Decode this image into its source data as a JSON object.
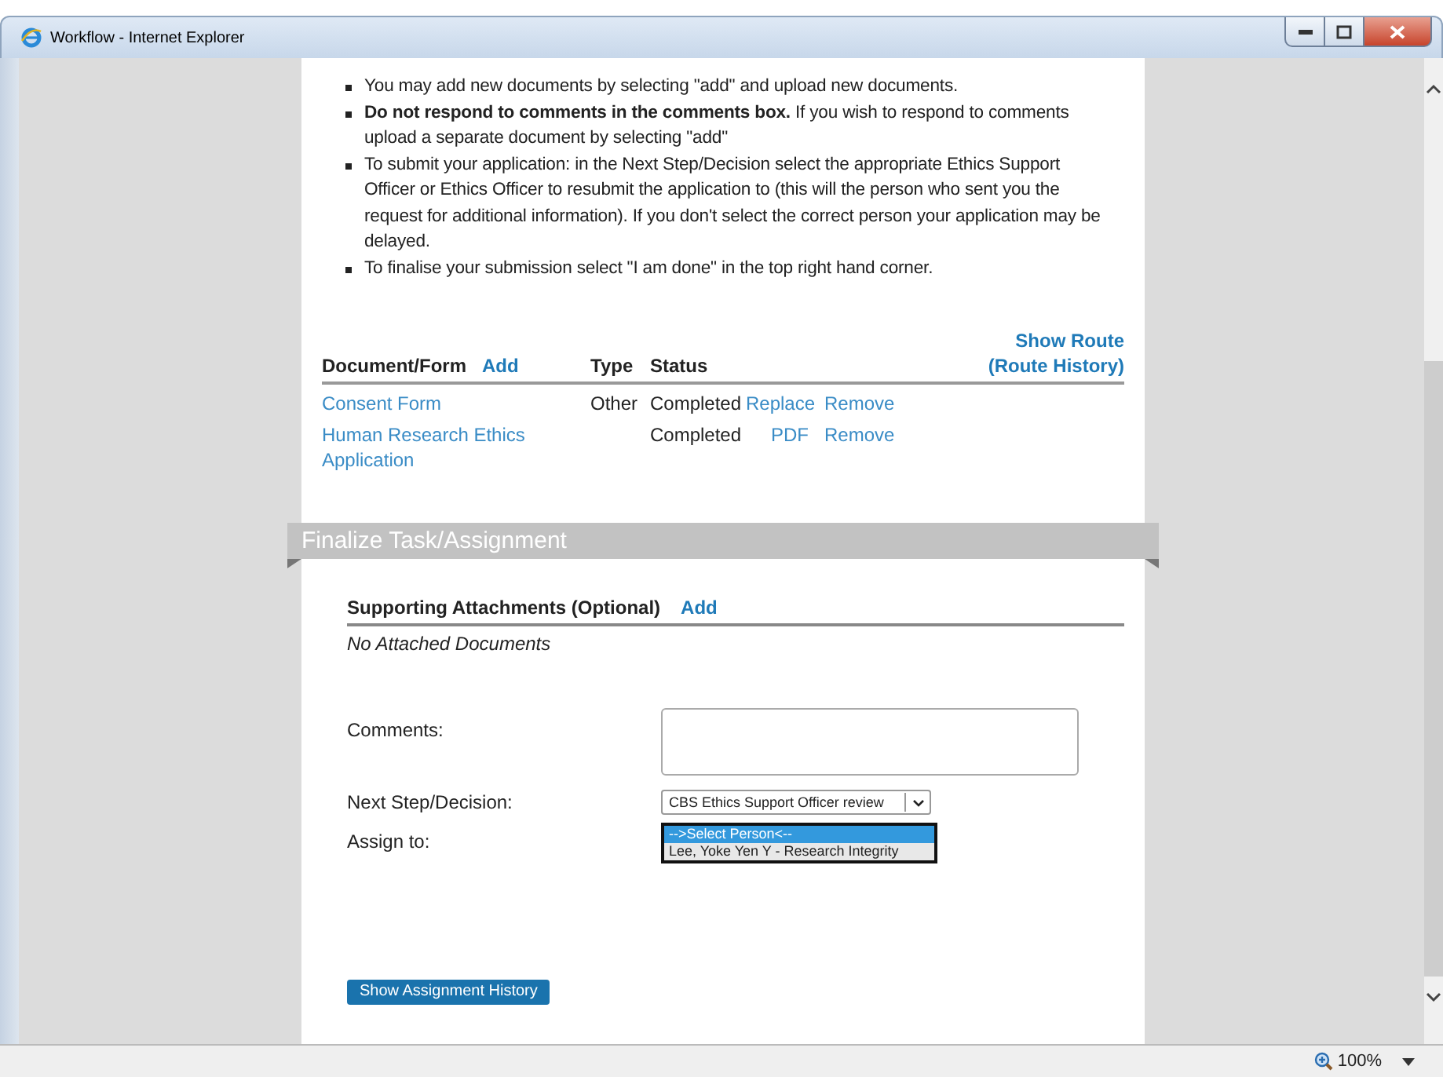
{
  "window": {
    "title": "Workflow - Internet Explorer"
  },
  "instructions": [
    {
      "text": "You may add new documents by selecting \"add\" and upload new documents."
    },
    {
      "text": "**Do not respond to comments in the comments box.** If you wish to respond to comments upload a separate document by selecting \"add\""
    },
    {
      "text": "To submit your application: in the Next Step/Decision select the appropriate Ethics Support Officer or Ethics Officer to resubmit the application to (this will the person who sent you the request for additional information). If you don't select the correct person your application may be delayed."
    },
    {
      "text": "To finalise your submission select \"I am done\" in the top right hand corner."
    }
  ],
  "documents": {
    "columns": [
      "Document/Form",
      "Type",
      "Status"
    ],
    "add_link": "Add",
    "show_route": "Show Route",
    "route_history": "(Route History)",
    "rows": [
      {
        "name": "Consent Form",
        "type": "Other",
        "status": "Completed",
        "actions": [
          "Replace",
          "Remove"
        ]
      },
      {
        "name": "Human Research Ethics Application",
        "status": "Completed",
        "actions": [
          "PDF",
          "Remove"
        ]
      }
    ]
  },
  "finalize": {
    "title": "Finalize Task/Assignment",
    "attachments_label": "Supporting Attachments (Optional)",
    "attachments_add": "Add",
    "attachments_empty": "No Attached Documents",
    "comments_label": "Comments:",
    "next_step_label": "Next Step/Decision:",
    "next_step_value": "CBS Ethics Support Officer review",
    "assign_label": "Assign to:",
    "assign_options": [
      {
        "label": "-->Select Person<--",
        "selected": true
      },
      {
        "label": "Lee, Yoke Yen Y - Research Integrity",
        "selected": false
      }
    ],
    "history_button": "Show Assignment History"
  },
  "status_bar": {
    "zoom": "100%"
  }
}
